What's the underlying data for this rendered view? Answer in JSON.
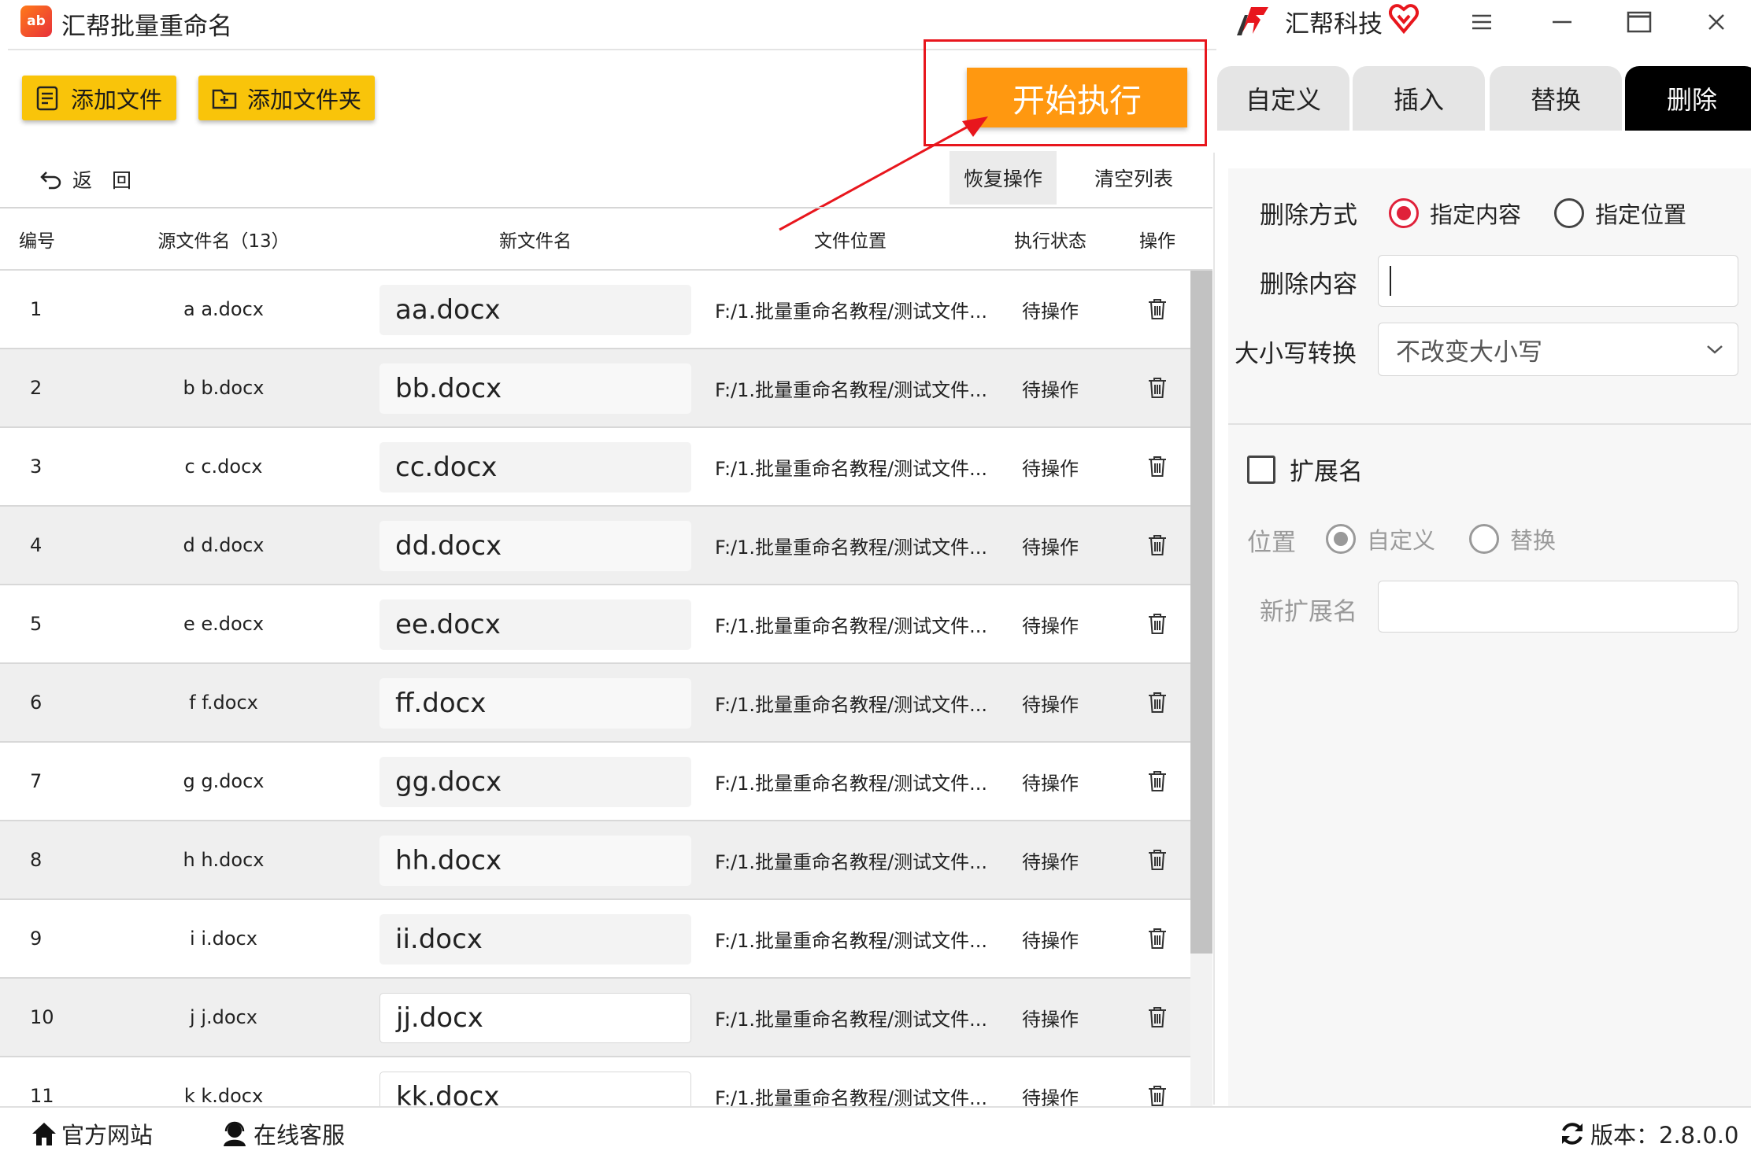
{
  "app": {
    "title": "汇帮批量重命名",
    "logo_text": "ab",
    "brand": "汇帮科技"
  },
  "toolbar": {
    "add_file": "添加文件",
    "add_folder": "添加文件夹",
    "start": "开始执行",
    "back": "返　回",
    "restore": "恢复操作",
    "clear": "清空列表"
  },
  "table": {
    "headers": {
      "id": "编号",
      "src": "源文件名（13）",
      "new": "新文件名",
      "loc": "文件位置",
      "status": "执行状态",
      "op": "操作"
    },
    "rows": [
      {
        "id": "1",
        "src": "a a.docx",
        "new": "aa.docx",
        "loc": "F:/1.批量重命名教程/测试文件...",
        "status": "待操作"
      },
      {
        "id": "2",
        "src": "b b.docx",
        "new": "bb.docx",
        "loc": "F:/1.批量重命名教程/测试文件...",
        "status": "待操作"
      },
      {
        "id": "3",
        "src": "c c.docx",
        "new": "cc.docx",
        "loc": "F:/1.批量重命名教程/测试文件...",
        "status": "待操作"
      },
      {
        "id": "4",
        "src": "d d.docx",
        "new": "dd.docx",
        "loc": "F:/1.批量重命名教程/测试文件...",
        "status": "待操作"
      },
      {
        "id": "5",
        "src": "e e.docx",
        "new": "ee.docx",
        "loc": "F:/1.批量重命名教程/测试文件...",
        "status": "待操作"
      },
      {
        "id": "6",
        "src": "f f.docx",
        "new": "ff.docx",
        "loc": "F:/1.批量重命名教程/测试文件...",
        "status": "待操作"
      },
      {
        "id": "7",
        "src": "g g.docx",
        "new": "gg.docx",
        "loc": "F:/1.批量重命名教程/测试文件...",
        "status": "待操作"
      },
      {
        "id": "8",
        "src": "h h.docx",
        "new": "hh.docx",
        "loc": "F:/1.批量重命名教程/测试文件...",
        "status": "待操作"
      },
      {
        "id": "9",
        "src": "i i.docx",
        "new": "ii.docx",
        "loc": "F:/1.批量重命名教程/测试文件...",
        "status": "待操作"
      },
      {
        "id": "10",
        "src": "j j.docx",
        "new": "jj.docx",
        "loc": "F:/1.批量重命名教程/测试文件...",
        "status": "待操作"
      },
      {
        "id": "11",
        "src": "k k.docx",
        "new": "kk.docx",
        "loc": "F:/1.批量重命名教程/测试文件...",
        "status": "待操作"
      }
    ]
  },
  "tabs": {
    "custom": "自定义",
    "insert": "插入",
    "replace": "替换",
    "delete": "删除",
    "active": "delete"
  },
  "panel": {
    "delete_mode_label": "删除方式",
    "mode_content": "指定内容",
    "mode_position": "指定位置",
    "selected_mode": "mode_content",
    "delete_content_label": "删除内容",
    "delete_content_value": "",
    "case_label": "大小写转换",
    "case_value": "不改变大小写",
    "ext_label": "扩展名",
    "ext_checked": false,
    "pos_label": "位置",
    "pos_custom": "自定义",
    "pos_replace": "替换",
    "new_ext_label": "新扩展名",
    "new_ext_value": ""
  },
  "statusbar": {
    "site": "官方网站",
    "service": "在线客服",
    "version": "版本：2.8.0.0"
  },
  "colors": {
    "accent_yellow": "#f9c40a",
    "start_orange": "#ff9810",
    "highlight_red": "#e8161d",
    "radio_red": "#e0213a"
  }
}
